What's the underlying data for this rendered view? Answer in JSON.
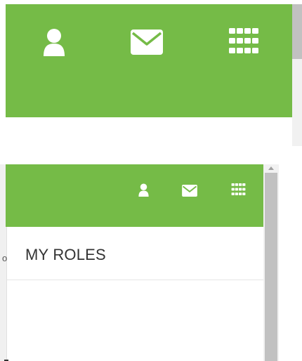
{
  "colors": {
    "header_green": "#75bb47",
    "icon_white": "#ffffff",
    "scrollbar_track": "#f1f1f1",
    "scrollbar_thumb": "#c1c1c1",
    "title_text": "#333333"
  },
  "header": {
    "icons": [
      "user-icon",
      "mail-icon",
      "apps-grid-icon"
    ]
  },
  "roles": {
    "title": "MY ROLES"
  },
  "cropped_text": "o"
}
